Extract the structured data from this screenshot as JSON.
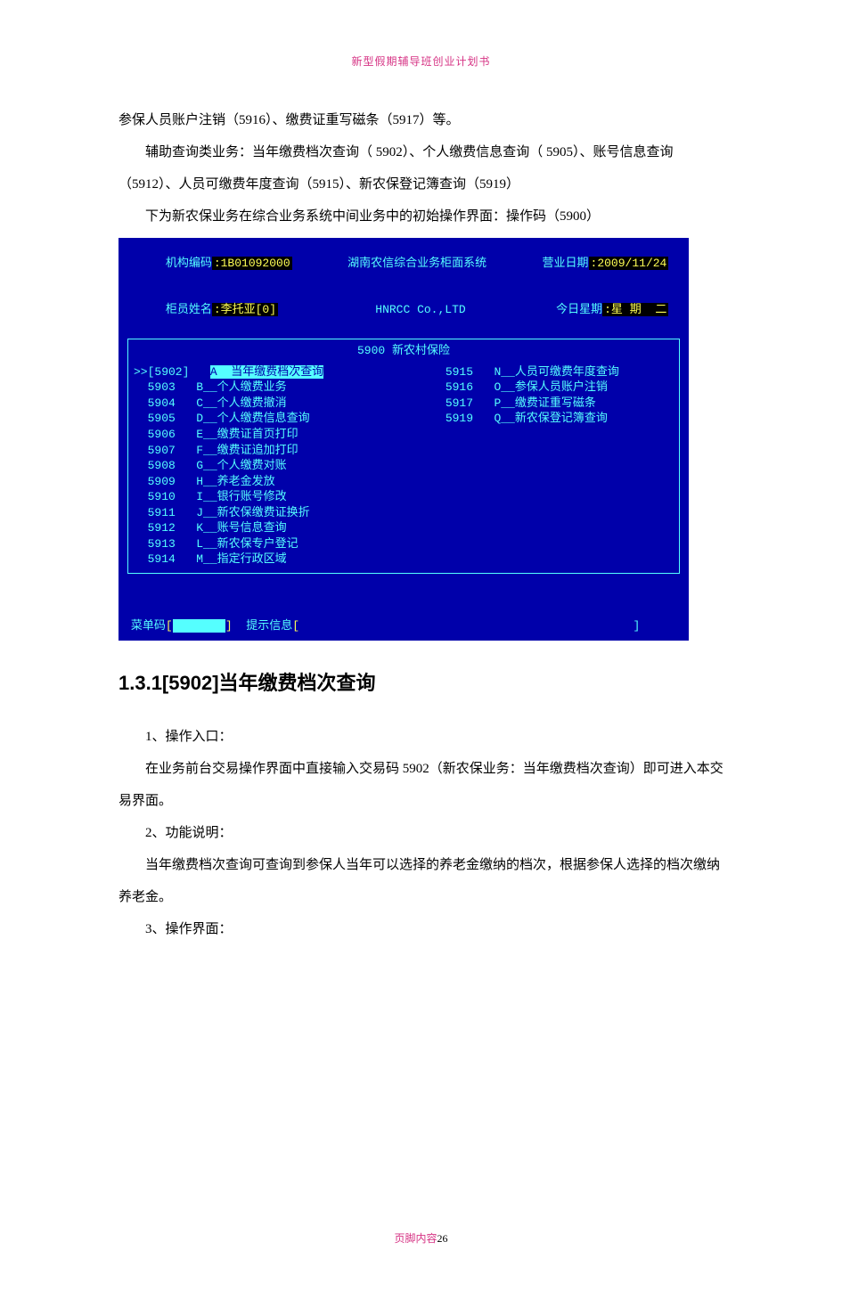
{
  "header": "新型假期辅导班创业计划书",
  "p1a": "参保人员账户注销（5916）、缴费证重写磁条（5917）等。",
  "p2": "辅助查询类业务：当年缴费档次查询（ 5902）、个人缴费信息查询（ 5905）、账号信息查询（5912）、人员可缴费年度查询（5915）、新农保登记簿查询（5919）",
  "p3": "下为新农保业务在综合业务系统中间业务中的初始操作界面：操作码（5900）",
  "terminal": {
    "org_label": "机构编码",
    "org_value": ":1B01092000",
    "teller_label": "柜员姓名",
    "teller_value": ":李托亚[0]",
    "sys_name": "湖南农信综合业务柜面系统",
    "company": "HNRCC Co.,LTD",
    "date_label": "营业日期",
    "date_value": ":2009/11/24",
    "week_label": "今日星期",
    "week_value": ":星 期  二",
    "menu_code": "5900",
    "menu_title": "新农村保险",
    "left": [
      {
        "code": ">>[5902]",
        "key": "A",
        "label": "当年缴费档次查询",
        "sel": true
      },
      {
        "code": "  5903",
        "key": "B",
        "label": "个人缴费业务"
      },
      {
        "code": "  5904",
        "key": "C",
        "label": "个人缴费撤消"
      },
      {
        "code": "  5905",
        "key": "D",
        "label": "个人缴费信息查询"
      },
      {
        "code": "  5906",
        "key": "E",
        "label": "缴费证首页打印"
      },
      {
        "code": "  5907",
        "key": "F",
        "label": "缴费证追加打印"
      },
      {
        "code": "  5908",
        "key": "G",
        "label": "个人缴费对账"
      },
      {
        "code": "  5909",
        "key": "H",
        "label": "养老金发放"
      },
      {
        "code": "  5910",
        "key": "I",
        "label": "银行账号修改"
      },
      {
        "code": "  5911",
        "key": "J",
        "label": "新农保缴费证换折"
      },
      {
        "code": "  5912",
        "key": "K",
        "label": "账号信息查询"
      },
      {
        "code": "  5913",
        "key": "L",
        "label": "新农保专户登记"
      },
      {
        "code": "  5914",
        "key": "M",
        "label": "指定行政区域"
      }
    ],
    "right": [
      {
        "code": "5915",
        "key": "N",
        "label": "人员可缴费年度查询"
      },
      {
        "code": "5916",
        "key": "O",
        "label": "参保人员账户注销"
      },
      {
        "code": "5917",
        "key": "P",
        "label": "缴费证重写磁条"
      },
      {
        "code": "5919",
        "key": "Q",
        "label": "新农保登记簿查询"
      }
    ],
    "footer_menu_label": "菜单码",
    "footer_hint_label": "提示信息"
  },
  "section_title": "1.3.1[5902]当年缴费档次查询",
  "s1": "1、操作入口：",
  "s2": "在业务前台交易操作界面中直接输入交易码 5902（新农保业务：当年缴费档次查询）即可进入本交易界面。",
  "s3": "2、功能说明：",
  "s4": "当年缴费档次查询可查询到参保人当年可以选择的养老金缴纳的档次，根据参保人选择的档次缴纳养老金。",
  "s5": "3、操作界面：",
  "footer_text": "页脚内容",
  "footer_num": "26"
}
